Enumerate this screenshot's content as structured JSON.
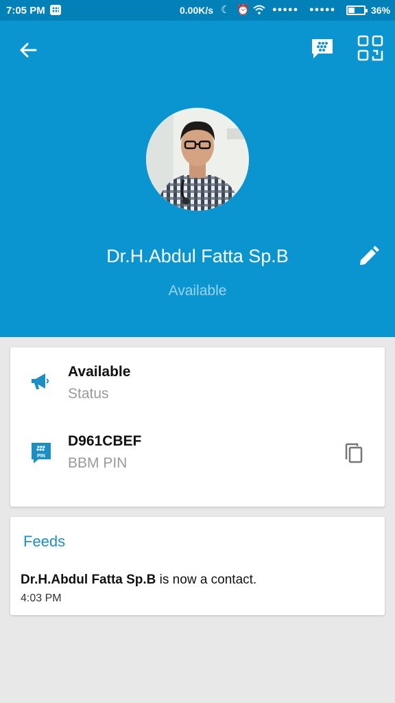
{
  "statusbar": {
    "time": "7:05 PM",
    "speed": "0.00K/s",
    "signal1": "●●●●●",
    "signal2": "●●●●●",
    "battery": "36%"
  },
  "profile": {
    "name": "Dr.H.Abdul Fatta Sp.B",
    "status": "Available"
  },
  "info": {
    "status_value": "Available",
    "status_label": "Status",
    "pin_value": "D961CBEF",
    "pin_label": "BBM PIN",
    "pin_badge": "PIN"
  },
  "feeds": {
    "title": "Feeds",
    "entry_name": "Dr.H.Abdul Fatta Sp.B",
    "entry_text": " is now a contact.",
    "entry_time": "4:03 PM"
  },
  "colors": {
    "header": "#0a95d0",
    "statusbar": "#0281b8",
    "accent": "#1b8fc4"
  },
  "icons": [
    "back-arrow-icon",
    "bbm-chat-icon",
    "qr-code-icon",
    "edit-pencil-icon",
    "megaphone-icon",
    "bbm-pin-icon",
    "copy-icon"
  ]
}
